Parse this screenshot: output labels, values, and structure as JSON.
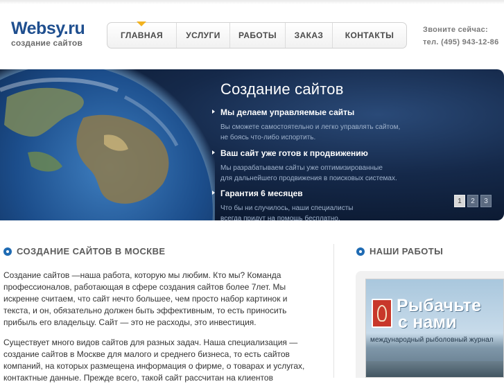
{
  "header": {
    "logo_title": "Websy.ru",
    "logo_subtitle": "создание сайтов",
    "contact_label": "Звоните сейчас:",
    "contact_phone": "тел. (495) 943-12-86"
  },
  "nav": {
    "items": [
      {
        "label": "ГЛАВНАЯ",
        "active": true
      },
      {
        "label": "УСЛУГИ"
      },
      {
        "label": "РАБОТЫ"
      },
      {
        "label": "ЗАКАЗ"
      },
      {
        "label": "КОНТАКТЫ"
      }
    ],
    "active_marker_color": "#f2b21f"
  },
  "banner": {
    "title": "Создание сайтов",
    "features": [
      {
        "heading": "Мы делаем управляемые сайты",
        "line1": "Вы сможете самостоятельно и легко управлять сайтом,",
        "line2": "не боясь что-либо испортить."
      },
      {
        "heading": "Ваш сайт уже готов к продвижению",
        "line1": "Мы разрабатываем сайты уже оптимизированные",
        "line2": "для дальнейшего продвижения в поисковых системах."
      },
      {
        "heading": "Гарантия 6 месяцев",
        "line1": "Что бы ни случилось, наши специалисты",
        "line2": "всегда придут на помощь бесплатно."
      }
    ],
    "pager": [
      "1",
      "2",
      "3"
    ],
    "active_page": 1
  },
  "main": {
    "heading": "СОЗДАНИЕ САЙТОВ В МОСКВЕ",
    "paragraph1": "Создание сайтов  —наша работа, которую мы любим. Кто мы? Команда профессионалов, работающая в сфере создания сайтов более  7лет. Мы искренне считаем, что сайт нечто большее, чем просто набор картинок и текста, и он, обязательно должен быть эффективным, то есть приносить прибыль его владельцу. Сайт — это не расходы, это инвестиция.",
    "paragraph2": "Существует много видов сайтов для разных задач. Наша специализация  — создание сайтов в Москве для малого и среднего бизнеса, то есть сайтов компаний, на которых размещена информация о фирме, о товарах и услугах, контактные данные. Прежде всего, такой сайт рассчитан на клиентов"
  },
  "works": {
    "heading": "НАШИ РАБОТЫ",
    "thumb_title_line1": "Рыбачьте",
    "thumb_title_line2": "с нами",
    "thumb_subtitle": "международный рыболовный журнал"
  },
  "colors": {
    "brand": "#1f4f8f",
    "accent_bullet": "#1f6bb3",
    "banner_bg": "#0c1a32"
  }
}
